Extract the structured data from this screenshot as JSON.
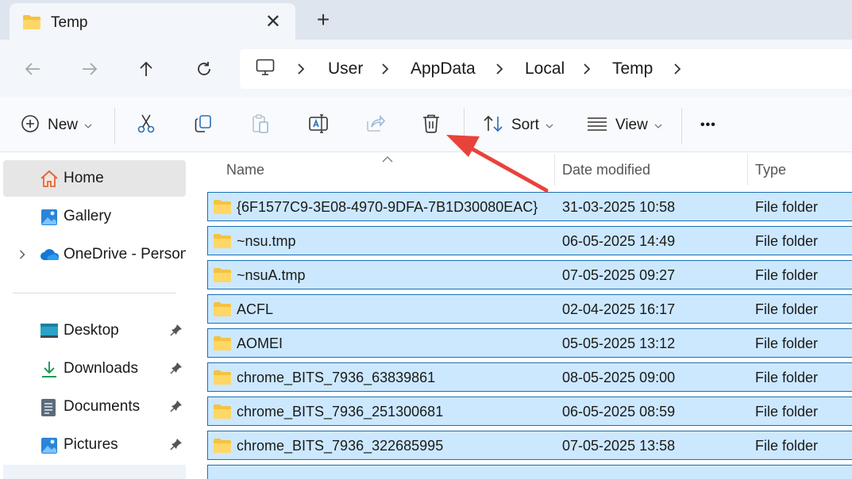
{
  "window": {
    "tab_title": "Temp",
    "close_tab_glyph": "✕",
    "new_tab_glyph": "+"
  },
  "nav": {
    "icons": [
      "back-arrow-icon",
      "forward-arrow-icon",
      "up-arrow-icon",
      "refresh-icon"
    ]
  },
  "address": {
    "root_icon": "computer-monitor-icon",
    "crumbs": [
      "User",
      "AppData",
      "Local",
      "Temp"
    ]
  },
  "toolbar": {
    "new_label": "New",
    "sort_label": "Sort",
    "view_label": "View",
    "more_glyph": "•••",
    "icons": [
      "cut-icon",
      "copy-icon",
      "paste-icon",
      "rename-icon",
      "share-icon",
      "delete-icon"
    ]
  },
  "sidebar": {
    "items": [
      {
        "label": "Home",
        "icon": "home-icon"
      },
      {
        "label": "Gallery",
        "icon": "gallery-icon"
      },
      {
        "label": "OneDrive - Persona",
        "icon": "onedrive-cloud-icon"
      },
      {
        "label": "Desktop",
        "icon": "desktop-icon"
      },
      {
        "label": "Downloads",
        "icon": "downloads-icon"
      },
      {
        "label": "Documents",
        "icon": "documents-icon"
      },
      {
        "label": "Pictures",
        "icon": "pictures-icon"
      }
    ]
  },
  "columns": {
    "name": "Name",
    "date": "Date modified",
    "type": "Type"
  },
  "files": [
    {
      "name": "{6F1577C9-3E08-4970-9DFA-7B1D30080EAC}",
      "date": "31-03-2025 10:58",
      "type": "File folder"
    },
    {
      "name": "~nsu.tmp",
      "date": "06-05-2025 14:49",
      "type": "File folder"
    },
    {
      "name": "~nsuA.tmp",
      "date": "07-05-2025 09:27",
      "type": "File folder"
    },
    {
      "name": "ACFL",
      "date": "02-04-2025 16:17",
      "type": "File folder"
    },
    {
      "name": "AOMEI",
      "date": "05-05-2025 13:12",
      "type": "File folder"
    },
    {
      "name": "chrome_BITS_7936_63839861",
      "date": "08-05-2025 09:00",
      "type": "File folder"
    },
    {
      "name": "chrome_BITS_7936_251300681",
      "date": "06-05-2025 08:59",
      "type": "File folder"
    },
    {
      "name": "chrome_BITS_7936_322685995",
      "date": "07-05-2025 13:58",
      "type": "File folder"
    }
  ],
  "colors": {
    "selection": "#cce8ff",
    "selection_border": "#1a6fb5",
    "annotation_arrow": "#e8433a",
    "folder_yellow": "#f5c242"
  }
}
